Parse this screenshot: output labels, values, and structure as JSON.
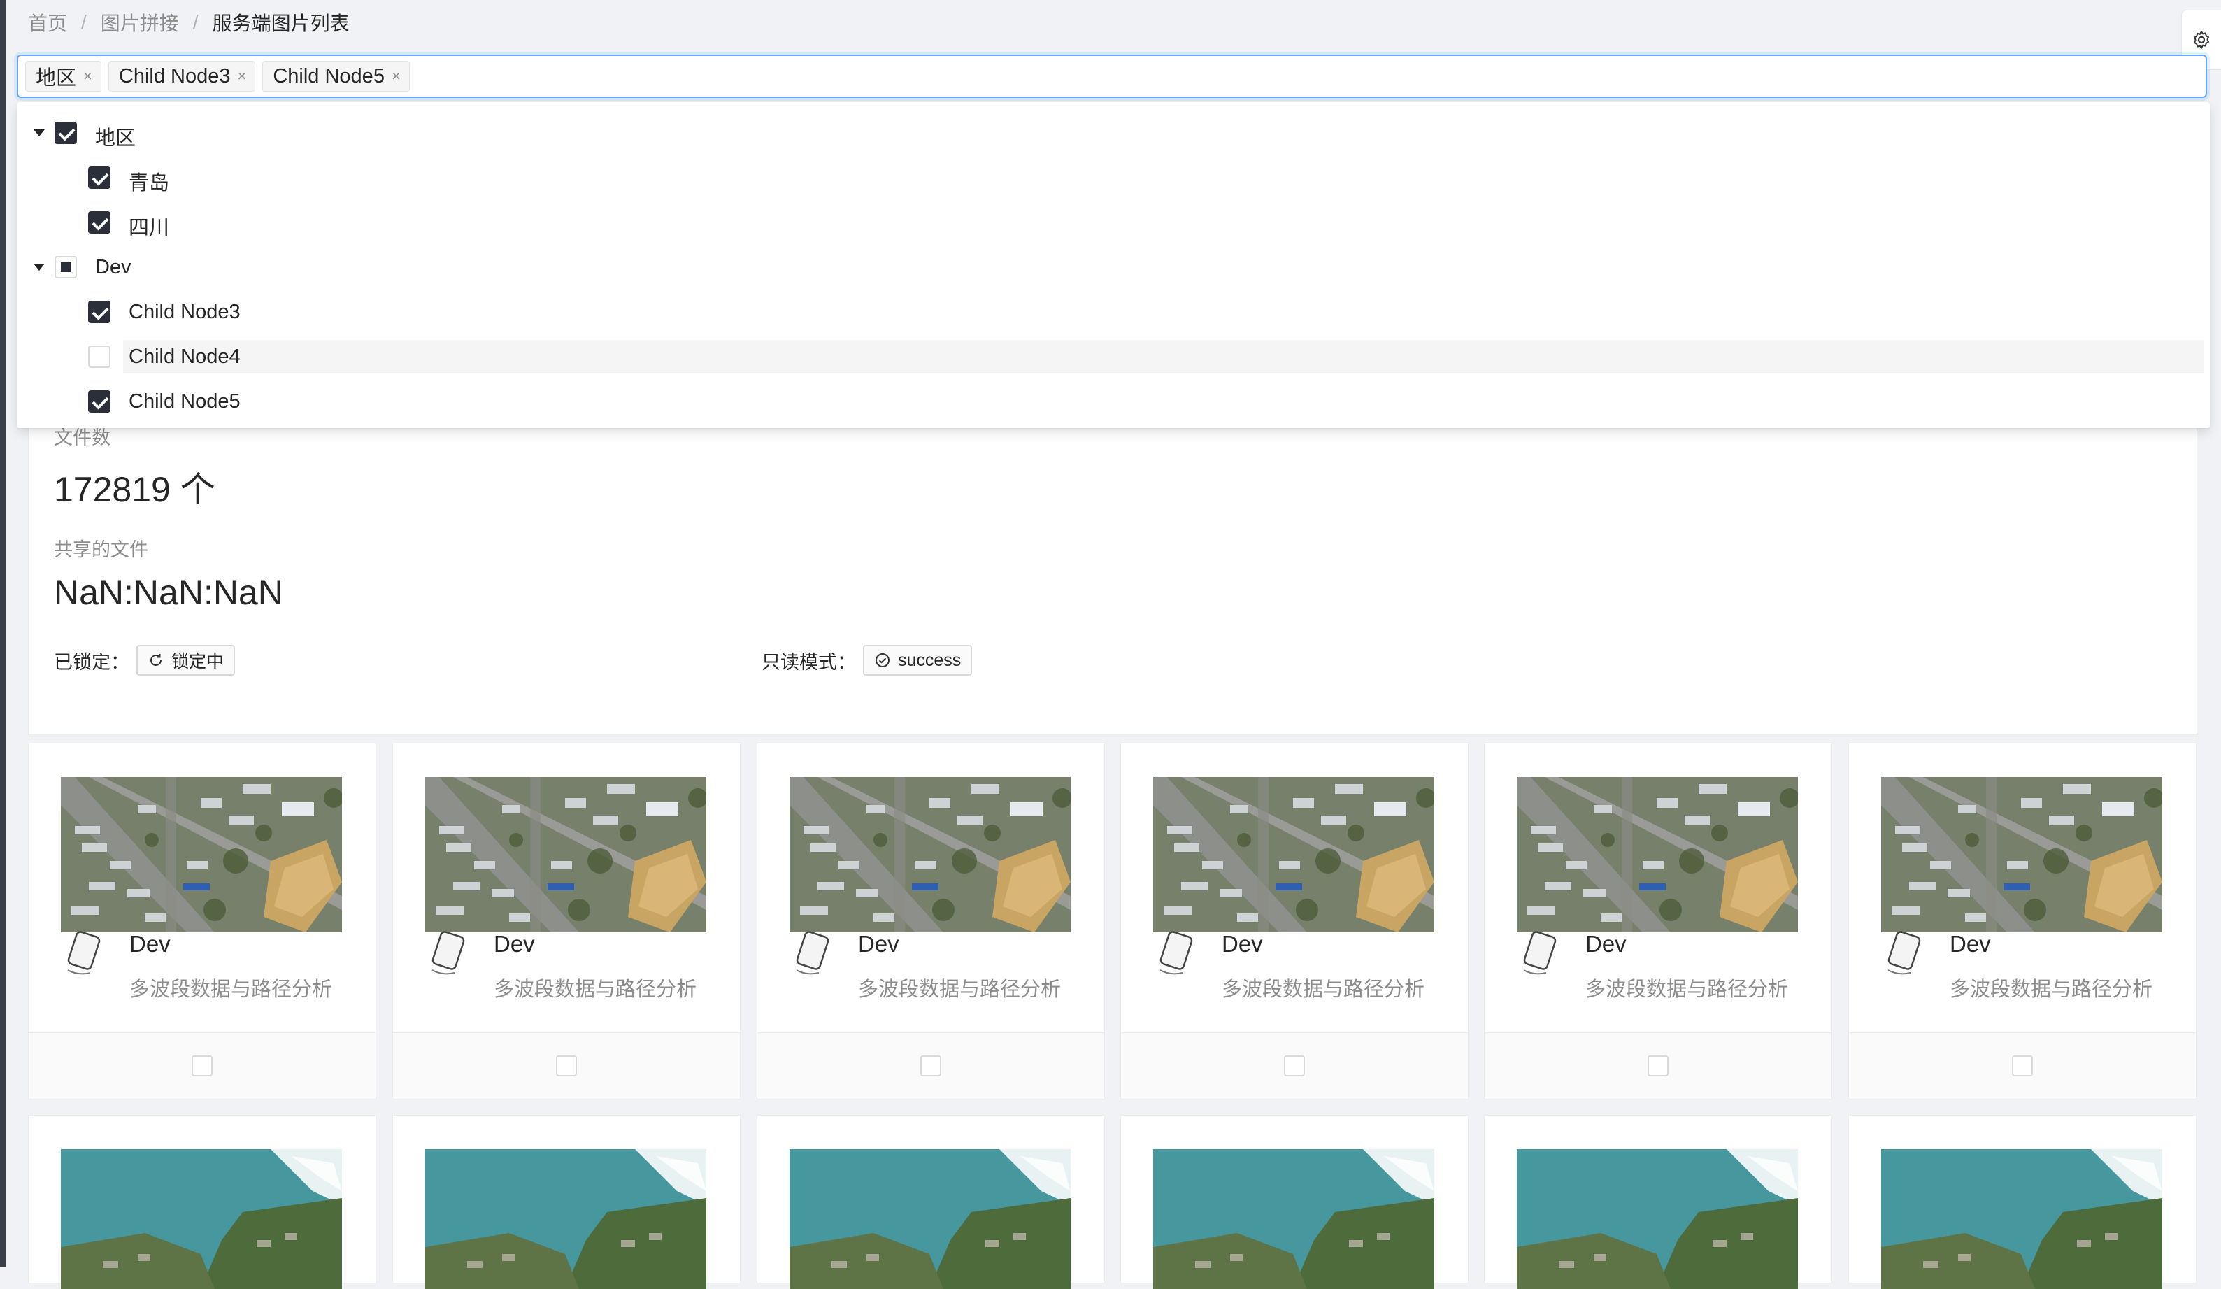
{
  "breadcrumb": {
    "home": "首页",
    "section": "图片拼接",
    "current": "服务端图片列表",
    "separator": "/"
  },
  "tree_select": {
    "tags": [
      {
        "label": "地区"
      },
      {
        "label": "Child Node3"
      },
      {
        "label": "Child Node5"
      }
    ],
    "remove_glyph": "×",
    "nodes": [
      {
        "label": "地区",
        "level": 0,
        "expanded": true,
        "state": "checked"
      },
      {
        "label": "青岛",
        "level": 1,
        "state": "checked"
      },
      {
        "label": "四川",
        "level": 1,
        "state": "checked"
      },
      {
        "label": "Dev",
        "level": 0,
        "expanded": true,
        "state": "partial"
      },
      {
        "label": "Child Node3",
        "level": 1,
        "state": "checked"
      },
      {
        "label": "Child Node4",
        "level": 1,
        "state": "unchecked",
        "hovered": true
      },
      {
        "label": "Child Node5",
        "level": 1,
        "state": "checked"
      }
    ]
  },
  "stats": {
    "file_count_title": "文件数",
    "file_count_value": "172819 个",
    "shared_title": "共享的文件",
    "shared_value": "NaN:NaN:NaN",
    "locked_label": "已锁定：",
    "locked_tag": "锁定中",
    "readonly_label": "只读模式：",
    "readonly_tag": "success"
  },
  "cards": [
    {
      "title": "Dev",
      "description": "多波段数据与路径分析",
      "image": "city-aerial"
    },
    {
      "title": "Dev",
      "description": "多波段数据与路径分析",
      "image": "city-aerial"
    },
    {
      "title": "Dev",
      "description": "多波段数据与路径分析",
      "image": "city-aerial"
    },
    {
      "title": "Dev",
      "description": "多波段数据与路径分析",
      "image": "city-aerial"
    },
    {
      "title": "Dev",
      "description": "多波段数据与路径分析",
      "image": "city-aerial"
    },
    {
      "title": "Dev",
      "description": "多波段数据与路径分析",
      "image": "city-aerial"
    }
  ],
  "cards_row2": [
    {
      "image": "coast-aerial"
    },
    {
      "image": "coast-aerial"
    },
    {
      "image": "coast-aerial"
    },
    {
      "image": "coast-aerial"
    },
    {
      "image": "coast-aerial"
    },
    {
      "image": "coast-aerial"
    }
  ],
  "icons": {
    "settings": "gear-icon",
    "locked": "sync-icon",
    "readonly": "check-circle-icon",
    "avatar": "document-icon"
  },
  "colors": {
    "accent_border": "#69a7f5",
    "checkbox": "#2b2f3a",
    "page_bg": "#f0f2f5"
  }
}
